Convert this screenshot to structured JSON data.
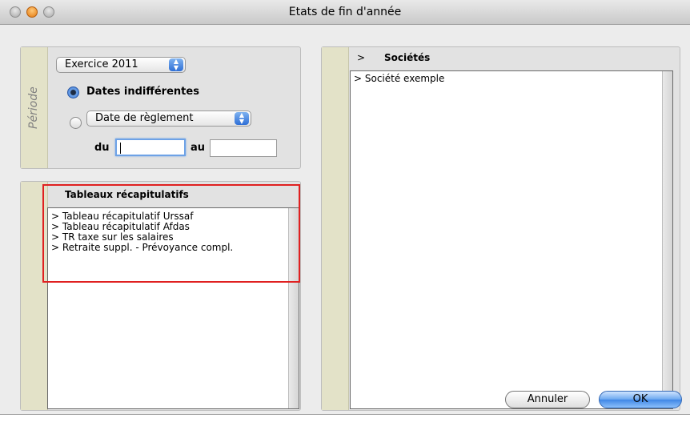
{
  "window": {
    "title": "Etats de fin d'année"
  },
  "periode": {
    "label": "Période",
    "exercice_select": "Exercice 2011",
    "radio_dates_indifferentes": "Dates indifférentes",
    "date_type_select": "Date de règlement",
    "du_label": "du",
    "au_label": "au",
    "du_value": "",
    "au_value": ""
  },
  "tableaux": {
    "title": "Tableaux récapitulatifs",
    "items": [
      "> Tableau récapitulatif Urssaf",
      "> Tableau récapitulatif Afdas",
      "> TR taxe sur les salaires",
      "> Retraite suppl. - Prévoyance compl."
    ]
  },
  "societes": {
    "expander": ">",
    "title": "Sociétés",
    "items": [
      "> Société exemple"
    ]
  },
  "buttons": {
    "cancel": "Annuler",
    "ok": "OK"
  },
  "colors": {
    "highlight": "#e02020",
    "accent": "#3f86e6"
  }
}
